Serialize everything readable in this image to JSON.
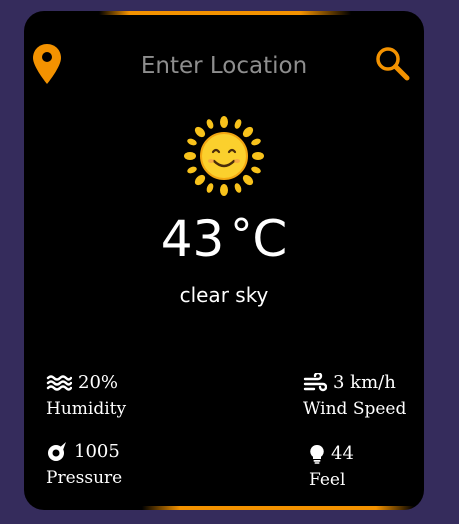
{
  "search": {
    "placeholder": "Enter Location"
  },
  "weather": {
    "temperature": "43",
    "degree_symbol": "°",
    "unit": "C",
    "description": "clear sky"
  },
  "stats": {
    "humidity": {
      "value": "20%",
      "label": "Humidity"
    },
    "wind": {
      "value": "3 km/h",
      "label": "Wind Speed"
    },
    "pressure": {
      "value": "1005",
      "label": "Pressure"
    },
    "feel": {
      "value": "44",
      "label": "Feel"
    }
  },
  "icons": {
    "location": "location-pin-icon",
    "search": "search-icon",
    "weather": "sun-icon",
    "humidity": "water-waves-icon",
    "wind": "wind-icon",
    "pressure": "pressure-gauge-icon",
    "feel": "lightbulb-icon"
  },
  "colors": {
    "background": "#352c5c",
    "card": "#000000",
    "accent": "#f39200",
    "text": "#ffffff",
    "placeholder": "#8e8e8e"
  }
}
